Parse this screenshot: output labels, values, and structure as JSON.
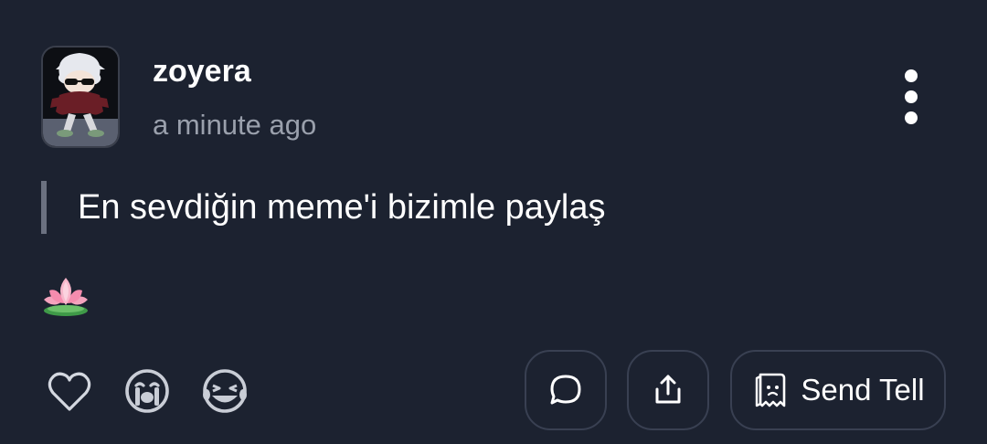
{
  "post": {
    "username": "zoyera",
    "timestamp": "a minute ago",
    "question": "En sevdiğin meme'i bizimle paylaş",
    "flair_icon": "lotus-emoji"
  },
  "reactions": [
    {
      "icon": "heart-outline-icon"
    },
    {
      "icon": "crying-face-icon"
    },
    {
      "icon": "laughing-face-icon"
    }
  ],
  "actions": {
    "comment_icon": "speech-bubble-icon",
    "share_icon": "share-upload-icon",
    "send_tell_icon": "ghost-note-icon",
    "send_tell_label": "Send Tell"
  },
  "colors": {
    "background": "#1c2230",
    "text_primary": "#ffffff",
    "text_secondary": "#9aa0ac",
    "border": "#394052",
    "icon": "#d4d8e0"
  }
}
